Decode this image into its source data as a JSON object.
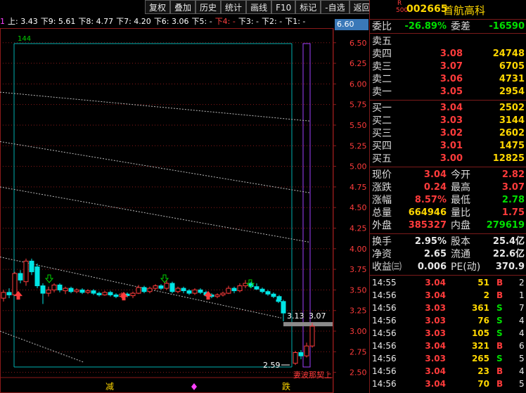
{
  "toolbar": [
    "复权",
    "叠加",
    "历史",
    "统计",
    "画线",
    "F10",
    "标记",
    "-自选",
    "返回"
  ],
  "ma_bar": [
    {
      "text": "1",
      "color": "#ff40ff"
    },
    {
      "text": "上: 3.43",
      "color": "#ffffff"
    },
    {
      "text": "下9: 5.61",
      "color": "#ffffff"
    },
    {
      "text": "下8: 4.77",
      "color": "#ffffff"
    },
    {
      "text": "下7: 4.20",
      "color": "#ffffff"
    },
    {
      "text": "下6: 3.06",
      "color": "#ffffff"
    },
    {
      "text": "下5: -",
      "color": "#ffffff"
    },
    {
      "text": "下4: -",
      "color": "#ff4040"
    },
    {
      "text": "下3: -",
      "color": "#ffffff"
    },
    {
      "text": "下2: -",
      "color": "#ffffff"
    },
    {
      "text": "下1: -",
      "color": "#ffffff"
    }
  ],
  "last_price_tag": "6.60",
  "stock": {
    "r_label": "R",
    "r_sub": "500",
    "code": "002665",
    "name": "首航高科"
  },
  "weibi": {
    "label": "委比",
    "value": "-26.89%",
    "label2": "委差",
    "value2": "-16590"
  },
  "sell": [
    {
      "label": "卖五",
      "price": "",
      "vol": ""
    },
    {
      "label": "卖四",
      "price": "3.08",
      "vol": "24748"
    },
    {
      "label": "卖三",
      "price": "3.07",
      "vol": "6705"
    },
    {
      "label": "卖二",
      "price": "3.06",
      "vol": "4731"
    },
    {
      "label": "卖一",
      "price": "3.05",
      "vol": "2954"
    }
  ],
  "buy": [
    {
      "label": "买一",
      "price": "3.04",
      "vol": "2502"
    },
    {
      "label": "买二",
      "price": "3.03",
      "vol": "3144"
    },
    {
      "label": "买三",
      "price": "3.02",
      "vol": "2602"
    },
    {
      "label": "买四",
      "price": "3.01",
      "vol": "1475"
    },
    {
      "label": "买五",
      "price": "3.00",
      "vol": "12825"
    }
  ],
  "quote": [
    {
      "l1": "现价",
      "v1": "3.04",
      "c1": "red",
      "l2": "今开",
      "v2": "2.82",
      "c2": "red"
    },
    {
      "l1": "涨跌",
      "v1": "0.24",
      "c1": "red",
      "l2": "最高",
      "v2": "3.07",
      "c2": "red"
    },
    {
      "l1": "涨幅",
      "v1": "8.57%",
      "c1": "red",
      "l2": "最低",
      "v2": "2.78",
      "c2": "green"
    },
    {
      "l1": "总量",
      "v1": "664946",
      "c1": "yel",
      "l2": "量比",
      "v2": "1.75",
      "c2": "red"
    },
    {
      "l1": "外盘",
      "v1": "385327",
      "c1": "red",
      "l2": "内盘",
      "v2": "279619",
      "c2": "green"
    }
  ],
  "stats": [
    {
      "l1": "换手",
      "v1": "2.95%",
      "l2": "股本",
      "v2": "25.4亿"
    },
    {
      "l1": "净资",
      "v1": "2.65",
      "l2": "流通",
      "v2": "22.6亿"
    },
    {
      "l1": "收益㈢",
      "v1": "0.006",
      "l2": "PE(动)",
      "v2": "370.9"
    }
  ],
  "ticks": [
    {
      "time": "14:55",
      "price": "3.04",
      "vol": "51",
      "bs": "B",
      "n": "2"
    },
    {
      "time": "14:56",
      "price": "3.04",
      "vol": "2",
      "bs": "B",
      "n": "1"
    },
    {
      "time": "14:56",
      "price": "3.03",
      "vol": "361",
      "bs": "S",
      "n": "7"
    },
    {
      "time": "14:56",
      "price": "3.03",
      "vol": "76",
      "bs": "S",
      "n": "4"
    },
    {
      "time": "14:56",
      "price": "3.03",
      "vol": "105",
      "bs": "S",
      "n": "4"
    },
    {
      "time": "14:56",
      "price": "3.04",
      "vol": "321",
      "bs": "B",
      "n": "6"
    },
    {
      "time": "14:56",
      "price": "3.03",
      "vol": "265",
      "bs": "S",
      "n": "5"
    },
    {
      "time": "14:56",
      "price": "3.04",
      "vol": "23",
      "bs": "B",
      "n": "4"
    },
    {
      "time": "14:56",
      "price": "3.04",
      "vol": "70",
      "bs": "B",
      "n": "5"
    }
  ],
  "chart_data": {
    "type": "candlestick",
    "y_ticks": [
      "6.50",
      "6.25",
      "6.00",
      "5.75",
      "5.50",
      "5.25",
      "5.00",
      "4.75",
      "4.50",
      "4.25",
      "4.00",
      "3.75",
      "3.50",
      "3.25",
      "3.00",
      "2.75",
      "2.50"
    ],
    "ylim": [
      2.42,
      6.66
    ],
    "bar_count_label": "144",
    "annotations": {
      "low": "2.59",
      "mid": "3.13",
      "high": "3.07",
      "signal": "妻波那契上"
    },
    "bottom_labels": [
      "减",
      "跌"
    ],
    "candles": [
      [
        3.4,
        3.47,
        3.36,
        3.5
      ],
      [
        3.47,
        3.44,
        3.4,
        3.52
      ],
      [
        3.44,
        3.7,
        3.43,
        3.72
      ],
      [
        3.7,
        3.62,
        3.58,
        3.74
      ],
      [
        3.6,
        3.85,
        3.55,
        3.88
      ],
      [
        3.85,
        3.72,
        3.68,
        3.88
      ],
      [
        3.78,
        3.55,
        3.52,
        3.82
      ],
      [
        3.55,
        3.46,
        3.33,
        3.58
      ],
      [
        3.46,
        3.5,
        3.42,
        3.54
      ],
      [
        3.5,
        3.56,
        3.47,
        3.58
      ],
      [
        3.56,
        3.5,
        3.47,
        3.58
      ],
      [
        3.49,
        3.52,
        3.45,
        3.54
      ],
      [
        3.52,
        3.48,
        3.46,
        3.54
      ],
      [
        3.48,
        3.5,
        3.46,
        3.52
      ],
      [
        3.5,
        3.47,
        3.45,
        3.52
      ],
      [
        3.47,
        3.49,
        3.45,
        3.51
      ],
      [
        3.49,
        3.46,
        3.44,
        3.51
      ],
      [
        3.46,
        3.44,
        3.42,
        3.48
      ],
      [
        3.44,
        3.47,
        3.43,
        3.49
      ],
      [
        3.47,
        3.44,
        3.42,
        3.49
      ],
      [
        3.44,
        3.42,
        3.4,
        3.46
      ],
      [
        3.42,
        3.45,
        3.4,
        3.47
      ],
      [
        3.45,
        3.43,
        3.41,
        3.47
      ],
      [
        3.43,
        3.46,
        3.4,
        3.48
      ],
      [
        3.46,
        3.53,
        3.45,
        3.56
      ],
      [
        3.53,
        3.48,
        3.46,
        3.55
      ],
      [
        3.48,
        3.52,
        3.46,
        3.54
      ],
      [
        3.52,
        3.55,
        3.5,
        3.57
      ],
      [
        3.55,
        3.52,
        3.5,
        3.57
      ],
      [
        3.52,
        3.58,
        3.5,
        3.62
      ],
      [
        3.58,
        3.48,
        3.46,
        3.6
      ],
      [
        3.48,
        3.52,
        3.46,
        3.54
      ],
      [
        3.52,
        3.49,
        3.46,
        3.54
      ],
      [
        3.49,
        3.46,
        3.44,
        3.51
      ],
      [
        3.46,
        3.5,
        3.44,
        3.52
      ],
      [
        3.5,
        3.47,
        3.45,
        3.52
      ],
      [
        3.47,
        3.44,
        3.42,
        3.49
      ],
      [
        3.44,
        3.42,
        3.4,
        3.46
      ],
      [
        3.42,
        3.44,
        3.4,
        3.46
      ],
      [
        3.44,
        3.46,
        3.42,
        3.48
      ],
      [
        3.46,
        3.52,
        3.45,
        3.55
      ],
      [
        3.52,
        3.49,
        3.46,
        3.54
      ],
      [
        3.49,
        3.55,
        3.47,
        3.58
      ],
      [
        3.55,
        3.58,
        3.52,
        3.62
      ],
      [
        3.58,
        3.54,
        3.52,
        3.6
      ],
      [
        3.54,
        3.51,
        3.5,
        3.58
      ],
      [
        3.51,
        3.48,
        3.46,
        3.53
      ],
      [
        3.48,
        3.45,
        3.43,
        3.5
      ],
      [
        3.45,
        3.42,
        3.4,
        3.47
      ],
      [
        3.42,
        3.38,
        3.36,
        3.44
      ],
      [
        3.38,
        3.36,
        3.34,
        3.4
      ],
      [
        3.36,
        3.22,
        3.12,
        3.38
      ],
      [
        2.61,
        2.74,
        2.59,
        2.76
      ],
      [
        2.74,
        2.7,
        2.66,
        2.77
      ],
      [
        2.7,
        2.82,
        2.68,
        2.86
      ],
      [
        2.82,
        3.06,
        2.8,
        3.1
      ]
    ]
  }
}
